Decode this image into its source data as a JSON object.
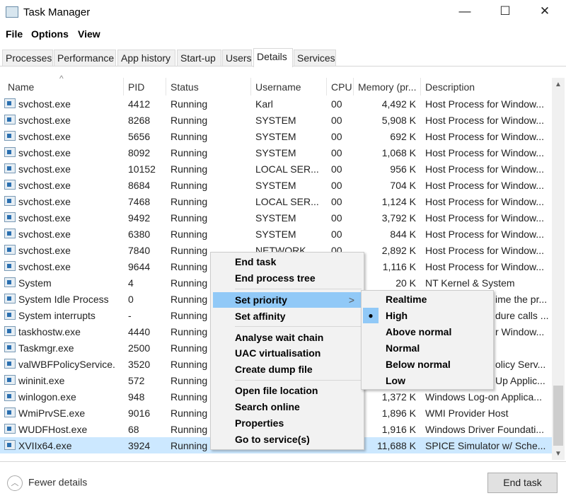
{
  "window": {
    "title": "Task Manager",
    "minimize": "—",
    "maximize": "☐",
    "close": "✕"
  },
  "menubar": [
    "File",
    "Options",
    "View"
  ],
  "tabs": [
    "Processes",
    "Performance",
    "App history",
    "Start-up",
    "Users",
    "Details",
    "Services"
  ],
  "active_tab": "Details",
  "columns": [
    "Name",
    "PID",
    "Status",
    "Username",
    "CPU",
    "Memory (pr...",
    "Description"
  ],
  "sort_indicator": "^",
  "rows": [
    {
      "name": "svchost.exe",
      "pid": "4412",
      "status": "Running",
      "user": "Karl",
      "cpu": "00",
      "mem": "4,492 K",
      "desc": "Host Process for Window..."
    },
    {
      "name": "svchost.exe",
      "pid": "8268",
      "status": "Running",
      "user": "SYSTEM",
      "cpu": "00",
      "mem": "5,908 K",
      "desc": "Host Process for Window..."
    },
    {
      "name": "svchost.exe",
      "pid": "5656",
      "status": "Running",
      "user": "SYSTEM",
      "cpu": "00",
      "mem": "692 K",
      "desc": "Host Process for Window..."
    },
    {
      "name": "svchost.exe",
      "pid": "8092",
      "status": "Running",
      "user": "SYSTEM",
      "cpu": "00",
      "mem": "1,068 K",
      "desc": "Host Process for Window..."
    },
    {
      "name": "svchost.exe",
      "pid": "10152",
      "status": "Running",
      "user": "LOCAL SER...",
      "cpu": "00",
      "mem": "956 K",
      "desc": "Host Process for Window..."
    },
    {
      "name": "svchost.exe",
      "pid": "8684",
      "status": "Running",
      "user": "SYSTEM",
      "cpu": "00",
      "mem": "704 K",
      "desc": "Host Process for Window..."
    },
    {
      "name": "svchost.exe",
      "pid": "7468",
      "status": "Running",
      "user": "LOCAL SER...",
      "cpu": "00",
      "mem": "1,124 K",
      "desc": "Host Process for Window..."
    },
    {
      "name": "svchost.exe",
      "pid": "9492",
      "status": "Running",
      "user": "SYSTEM",
      "cpu": "00",
      "mem": "3,792 K",
      "desc": "Host Process for Window..."
    },
    {
      "name": "svchost.exe",
      "pid": "6380",
      "status": "Running",
      "user": "SYSTEM",
      "cpu": "00",
      "mem": "844 K",
      "desc": "Host Process for Window..."
    },
    {
      "name": "svchost.exe",
      "pid": "7840",
      "status": "Running",
      "user": "NETWORK...",
      "cpu": "00",
      "mem": "2,892 K",
      "desc": "Host Process for Window..."
    },
    {
      "name": "svchost.exe",
      "pid": "9644",
      "status": "Running",
      "user": "",
      "cpu": "",
      "mem": "1,116 K",
      "desc": "Host Process for Window..."
    },
    {
      "name": "System",
      "pid": "4",
      "status": "Running",
      "user": "",
      "cpu": "",
      "mem": "20 K",
      "desc": "NT Kernel & System"
    },
    {
      "name": "System Idle Process",
      "pid": "0",
      "status": "Running",
      "user": "",
      "cpu": "",
      "mem": "",
      "desc": "ime the pr...",
      "partial": true
    },
    {
      "name": "System interrupts",
      "pid": "-",
      "status": "Running",
      "user": "",
      "cpu": "",
      "mem": "",
      "desc": "dure calls ...",
      "partial": true
    },
    {
      "name": "taskhostw.exe",
      "pid": "4440",
      "status": "Running",
      "user": "",
      "cpu": "",
      "mem": "",
      "desc": "r Window...",
      "partial": true
    },
    {
      "name": "Taskmgr.exe",
      "pid": "2500",
      "status": "Running",
      "user": "",
      "cpu": "",
      "mem": "",
      "desc": ""
    },
    {
      "name": "valWBFPolicyService.",
      "pid": "3520",
      "status": "Running",
      "user": "",
      "cpu": "",
      "mem": "",
      "desc": "olicy Serv...",
      "partial": true
    },
    {
      "name": "wininit.exe",
      "pid": "572",
      "status": "Running",
      "user": "",
      "cpu": "",
      "mem": "",
      "desc": "Up Applic...",
      "partial": true
    },
    {
      "name": "winlogon.exe",
      "pid": "948",
      "status": "Running",
      "user": "",
      "cpu": "",
      "mem": "1,372 K",
      "desc": "Windows Log-on Applica..."
    },
    {
      "name": "WmiPrvSE.exe",
      "pid": "9016",
      "status": "Running",
      "user": "",
      "cpu": "",
      "mem": "1,896 K",
      "desc": "WMI Provider Host"
    },
    {
      "name": "WUDFHost.exe",
      "pid": "68",
      "status": "Running",
      "user": "",
      "cpu": "",
      "mem": "1,916 K",
      "desc": "Windows Driver Foundati..."
    },
    {
      "name": "XVIIx64.exe",
      "pid": "3924",
      "status": "Running",
      "user": "",
      "cpu": "",
      "mem": "11,688 K",
      "desc": "SPICE Simulator w/ Sche...",
      "selected": true
    }
  ],
  "context_menu": {
    "items": [
      "End task",
      "End process tree",
      "Set priority",
      "Set affinity",
      "Analyse wait chain",
      "UAC virtualisation",
      "Create dump file",
      "Open file location",
      "Search online",
      "Properties",
      "Go to service(s)"
    ],
    "highlighted": "Set priority",
    "submenu_arrow": ">"
  },
  "priority_submenu": {
    "items": [
      "Realtime",
      "High",
      "Above normal",
      "Normal",
      "Below normal",
      "Low"
    ],
    "selected": "High",
    "bullet": "●"
  },
  "footer": {
    "fewer_details": "Fewer details",
    "end_task": "End task"
  },
  "colors": {
    "selection": "#cce8ff",
    "menu_highlight": "#91c9f7"
  }
}
